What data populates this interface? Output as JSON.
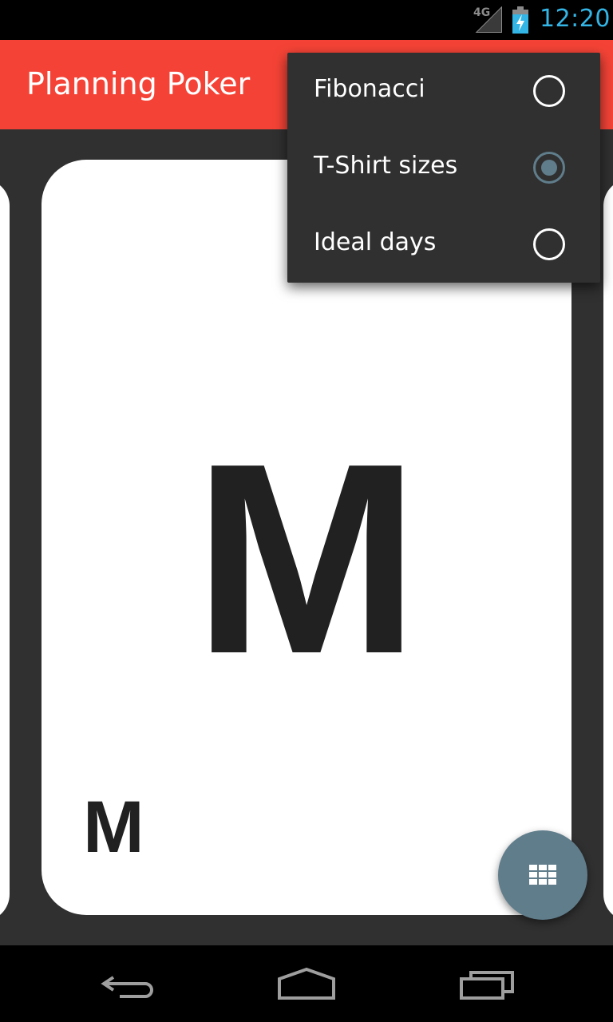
{
  "status_bar": {
    "network": "4G",
    "time": "12:20",
    "clock_color": "#33b5e5",
    "icons": [
      "signal-icon",
      "battery-charging-icon"
    ]
  },
  "app_bar": {
    "title": "Planning Poker",
    "color": "#f44336"
  },
  "card": {
    "value": "M",
    "corner_value": "M"
  },
  "overflow_menu": {
    "items": [
      {
        "label": "Fibonacci",
        "selected": false
      },
      {
        "label": "T-Shirt sizes",
        "selected": true
      },
      {
        "label": "Ideal days",
        "selected": false
      }
    ]
  },
  "fab": {
    "icon": "grid-icon",
    "color": "#607d8b"
  },
  "nav_bar": {
    "icons": [
      "back-icon",
      "home-icon",
      "recent-apps-icon"
    ]
  }
}
